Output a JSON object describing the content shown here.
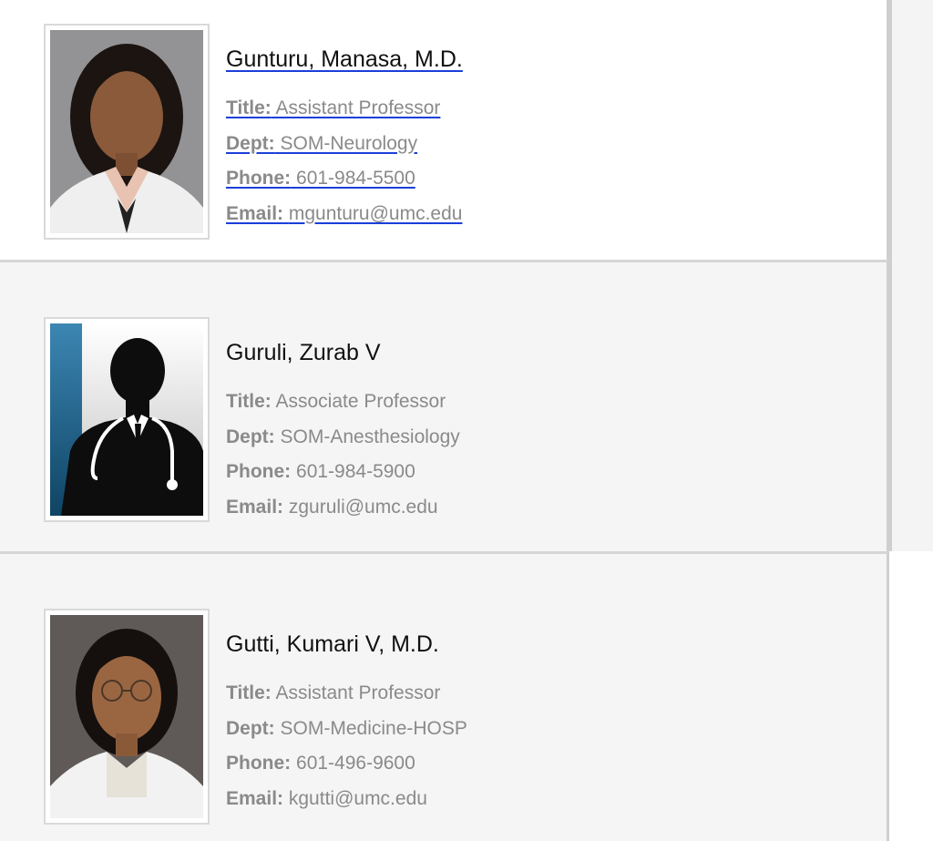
{
  "people": [
    {
      "name": "Gunturu, Manasa, M.D.",
      "title_label": "Title:",
      "title": "Assistant Professor",
      "dept_label": "Dept:",
      "dept": "SOM-Neurology",
      "phone_label": "Phone:",
      "phone": "601-984-5500",
      "email_label": "Email:",
      "email": "mgunturu@umc.edu"
    },
    {
      "name": "Guruli, Zurab V",
      "title_label": "Title:",
      "title": "Associate Professor",
      "dept_label": "Dept:",
      "dept": "SOM-Anesthesiology",
      "phone_label": "Phone:",
      "phone": "601-984-5900",
      "email_label": "Email:",
      "email": "zguruli@umc.edu"
    },
    {
      "name": "Gutti, Kumari V, M.D.",
      "title_label": "Title:",
      "title": "Assistant Professor",
      "dept_label": "Dept:",
      "dept": "SOM-Medicine-HOSP",
      "phone_label": "Phone:",
      "phone": "601-496-9600",
      "email_label": "Email:",
      "email": "kgutti@umc.edu"
    }
  ],
  "colors": {
    "link_underline": "#1a3fd9",
    "label_text": "#8a8a8a",
    "name_text": "#111111",
    "card_alt_bg": "#f5f5f5"
  },
  "icons": {
    "placeholder_photo": "doctor-silhouette-icon"
  }
}
